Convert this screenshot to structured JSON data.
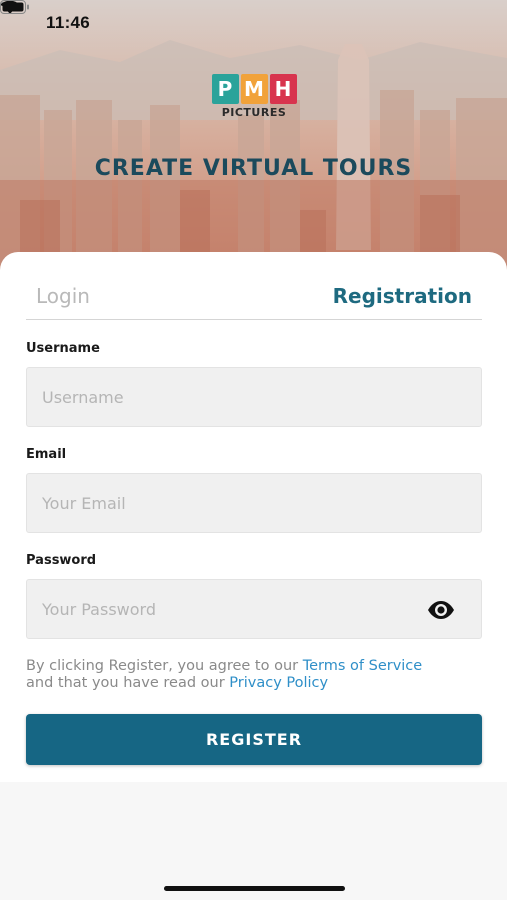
{
  "status_bar": {
    "time": "11:46"
  },
  "logo": {
    "letters": [
      {
        "char": "P",
        "color": "#2aa39a"
      },
      {
        "char": "M",
        "color": "#f1a23a"
      },
      {
        "char": "H",
        "color": "#d8344e"
      }
    ],
    "subtitle": "PICTURES"
  },
  "headline": "CREATE VIRTUAL TOURS",
  "tabs": {
    "login": "Login",
    "registration": "Registration",
    "active": "registration"
  },
  "form": {
    "username": {
      "label": "Username",
      "placeholder": "Username",
      "value": ""
    },
    "email": {
      "label": "Email",
      "placeholder": "Your Email",
      "value": ""
    },
    "password": {
      "label": "Password",
      "placeholder": "Your Password",
      "value": "",
      "toggle_icon": "eye-icon"
    }
  },
  "terms": {
    "prefix": "By clicking Register, you agree to our ",
    "terms_link": "Terms of Service",
    "middle": "and that you have read our ",
    "privacy_link": "Privacy Policy"
  },
  "register_button": "REGISTER",
  "colors": {
    "primary": "#166684",
    "tab_active": "#1e6a80",
    "link": "#2f8fc8"
  }
}
